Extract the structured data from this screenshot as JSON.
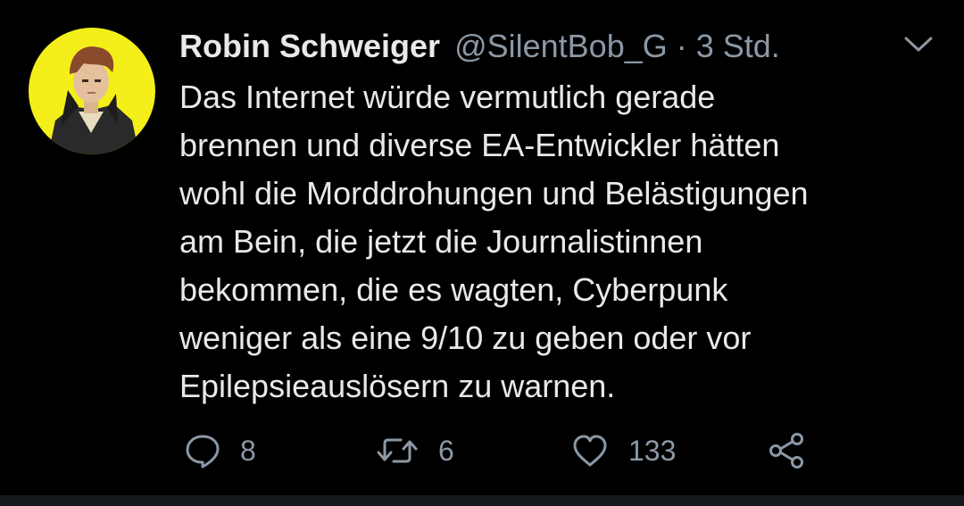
{
  "tweet": {
    "author_name": "Robin Schweiger",
    "author_handle": "@SilentBob_G",
    "separator": " · ",
    "timestamp": "3 Std.",
    "body_lines": [
      "Das Internet würde vermutlich gerade",
      "brennen und diverse EA-Entwickler hätten",
      "wohl die Morddrohungen und Belästigungen",
      "am Bein, die jetzt die Journalistinnen",
      "bekommen, die es wagten, Cyberpunk",
      "weniger als eine 9/10 zu geben oder vor",
      "Epilepsieauslösern zu warnen."
    ],
    "actions": {
      "reply_count": "8",
      "retweet_count": "6",
      "like_count": "133"
    }
  },
  "icons": {
    "menu": "chevron-down-icon",
    "reply": "comment-bubble-icon",
    "retweet": "retweet-arrows-icon",
    "like": "heart-icon",
    "share": "share-nodes-icon"
  },
  "colors": {
    "background": "#000000",
    "primary_text": "#e7e9ea",
    "secondary_text": "#8b98a5",
    "avatar_background": "#f4ee1a"
  }
}
